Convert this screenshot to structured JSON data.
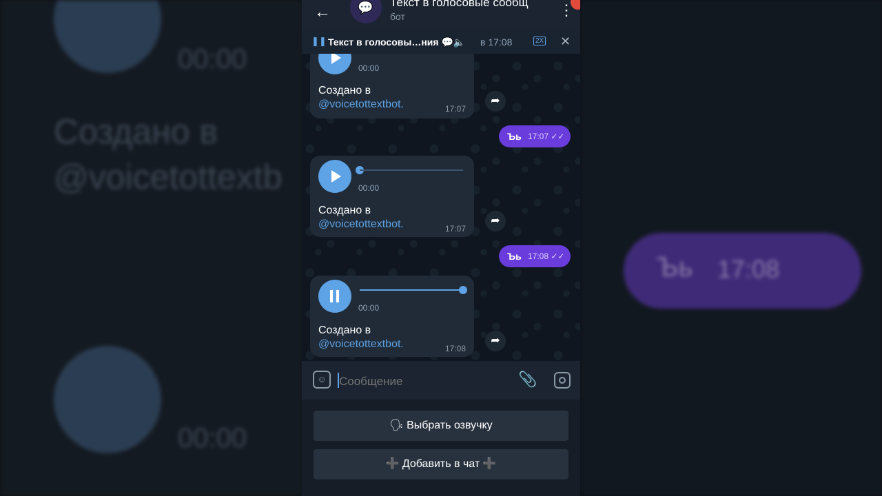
{
  "chat": {
    "title": "Текст в голосовые сообщ",
    "subtitle": "бот"
  },
  "player": {
    "title": "Текст в голосовы…ния 💬🔈",
    "time": "в 17:08",
    "speed": "2X"
  },
  "messages": [
    {
      "type": "voice",
      "duration": "00:00",
      "text": "Создано в",
      "handle": "@voicetottextbot.",
      "time": "17:07"
    },
    {
      "type": "out",
      "text": "Ъь",
      "time": "17:07 ✓✓"
    },
    {
      "type": "voice",
      "duration": "00:00",
      "text": "Создано в",
      "handle": "@voicetottextbot.",
      "time": "17:07"
    },
    {
      "type": "out",
      "text": "Ъь",
      "time": "17:08 ✓✓"
    },
    {
      "type": "voice",
      "duration": "00:00",
      "text": "Создано в",
      "handle": "@voicetottextbot.",
      "time": "17:08",
      "progress": 1.0
    }
  ],
  "input": {
    "placeholder": "Сообщение"
  },
  "keyboard": {
    "button1": "🗣 Выбрать озвучку",
    "button2": "Добавить в чат"
  },
  "background": {
    "duration1": "00:00",
    "created": "Создано в",
    "handle": "@voicetottextb",
    "out_text": "Ъь",
    "out_time": "17:08",
    "duration2": "00:00"
  },
  "colors": {
    "accent": "#5ea3e5",
    "outgoing": "#6a3cdc"
  }
}
